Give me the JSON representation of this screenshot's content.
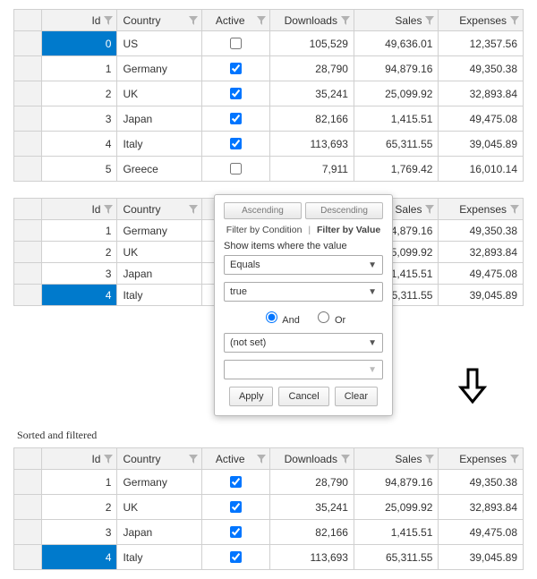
{
  "headers": {
    "id": "Id",
    "country": "Country",
    "active": "Active",
    "downloads": "Downloads",
    "sales": "Sales",
    "expenses": "Expenses"
  },
  "grid1": {
    "rows": [
      {
        "id": "0",
        "country": "US",
        "active": false,
        "downloads": "105,529",
        "sales": "49,636.01",
        "expenses": "12,357.56",
        "selected": true
      },
      {
        "id": "1",
        "country": "Germany",
        "active": true,
        "downloads": "28,790",
        "sales": "94,879.16",
        "expenses": "49,350.38",
        "selected": false
      },
      {
        "id": "2",
        "country": "UK",
        "active": true,
        "downloads": "35,241",
        "sales": "25,099.92",
        "expenses": "32,893.84",
        "selected": false
      },
      {
        "id": "3",
        "country": "Japan",
        "active": true,
        "downloads": "82,166",
        "sales": "1,415.51",
        "expenses": "49,475.08",
        "selected": false
      },
      {
        "id": "4",
        "country": "Italy",
        "active": true,
        "downloads": "113,693",
        "sales": "65,311.55",
        "expenses": "39,045.89",
        "selected": false
      },
      {
        "id": "5",
        "country": "Greece",
        "active": false,
        "downloads": "7,911",
        "sales": "1,769.42",
        "expenses": "16,010.14",
        "selected": false
      }
    ]
  },
  "grid2": {
    "rows": [
      {
        "id": "1",
        "country": "Germany",
        "sales": "94,879.16",
        "expenses": "49,350.38",
        "selected": false
      },
      {
        "id": "2",
        "country": "UK",
        "sales": "25,099.92",
        "expenses": "32,893.84",
        "selected": false
      },
      {
        "id": "3",
        "country": "Japan",
        "sales": "1,415.51",
        "expenses": "49,475.08",
        "selected": false
      },
      {
        "id": "4",
        "country": "Italy",
        "sales": "65,311.55",
        "expenses": "39,045.89",
        "selected": true
      }
    ]
  },
  "popup": {
    "sort_asc": "Ascending",
    "sort_desc": "Descending",
    "tab_condition": "Filter by Condition",
    "tab_value": "Filter by Value",
    "show_label": "Show items where the value",
    "op1": "Equals",
    "val1": "true",
    "and": "And",
    "or": "Or",
    "op2": "(not set)",
    "val2": "",
    "apply": "Apply",
    "cancel": "Cancel",
    "clear": "Clear"
  },
  "caption": "Sorted and filtered",
  "grid3": {
    "rows": [
      {
        "id": "1",
        "country": "Germany",
        "active": true,
        "downloads": "28,790",
        "sales": "94,879.16",
        "expenses": "49,350.38",
        "selected": false
      },
      {
        "id": "2",
        "country": "UK",
        "active": true,
        "downloads": "35,241",
        "sales": "25,099.92",
        "expenses": "32,893.84",
        "selected": false
      },
      {
        "id": "3",
        "country": "Japan",
        "active": true,
        "downloads": "82,166",
        "sales": "1,415.51",
        "expenses": "49,475.08",
        "selected": false
      },
      {
        "id": "4",
        "country": "Italy",
        "active": true,
        "downloads": "113,693",
        "sales": "65,311.55",
        "expenses": "39,045.89",
        "selected": true
      }
    ]
  }
}
